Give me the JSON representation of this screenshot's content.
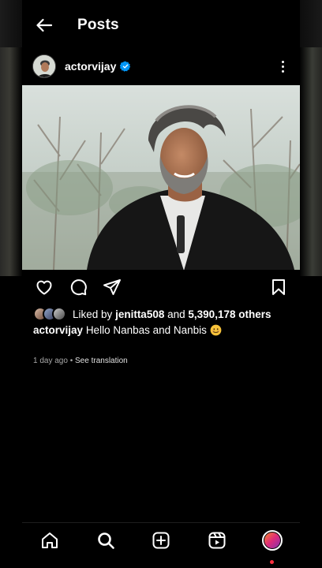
{
  "header": {
    "title": "Posts",
    "back_icon": "arrow-left-icon"
  },
  "post": {
    "username": "actorvijay",
    "verified_icon": "verified-badge-icon",
    "more_icon": "more-vertical-icon",
    "image_alt": "Man with grey hair and beard smiling, wearing black jacket, outdoors with trees in background",
    "likes": {
      "prefix": "Liked by",
      "user": "jenitta508",
      "middle": "and",
      "count": "5,390,178 others"
    },
    "caption": {
      "username": "actorvijay",
      "text": "Hello Nanbas and Nanbis",
      "emoji": "smiling-face-emoji"
    },
    "meta": {
      "time": "1 day ago",
      "separator": "•",
      "translate": "See translation"
    }
  },
  "actions": [
    "heart-icon",
    "comment-icon",
    "share-icon",
    "bookmark-icon"
  ],
  "nav": [
    "home-icon",
    "search-icon",
    "create-icon",
    "reels-icon",
    "profile-icon"
  ],
  "colors": {
    "background": "#000000",
    "verified": "#0095f6",
    "notification_dot": "#ff3040",
    "meta_text": "#a8a8a8"
  }
}
